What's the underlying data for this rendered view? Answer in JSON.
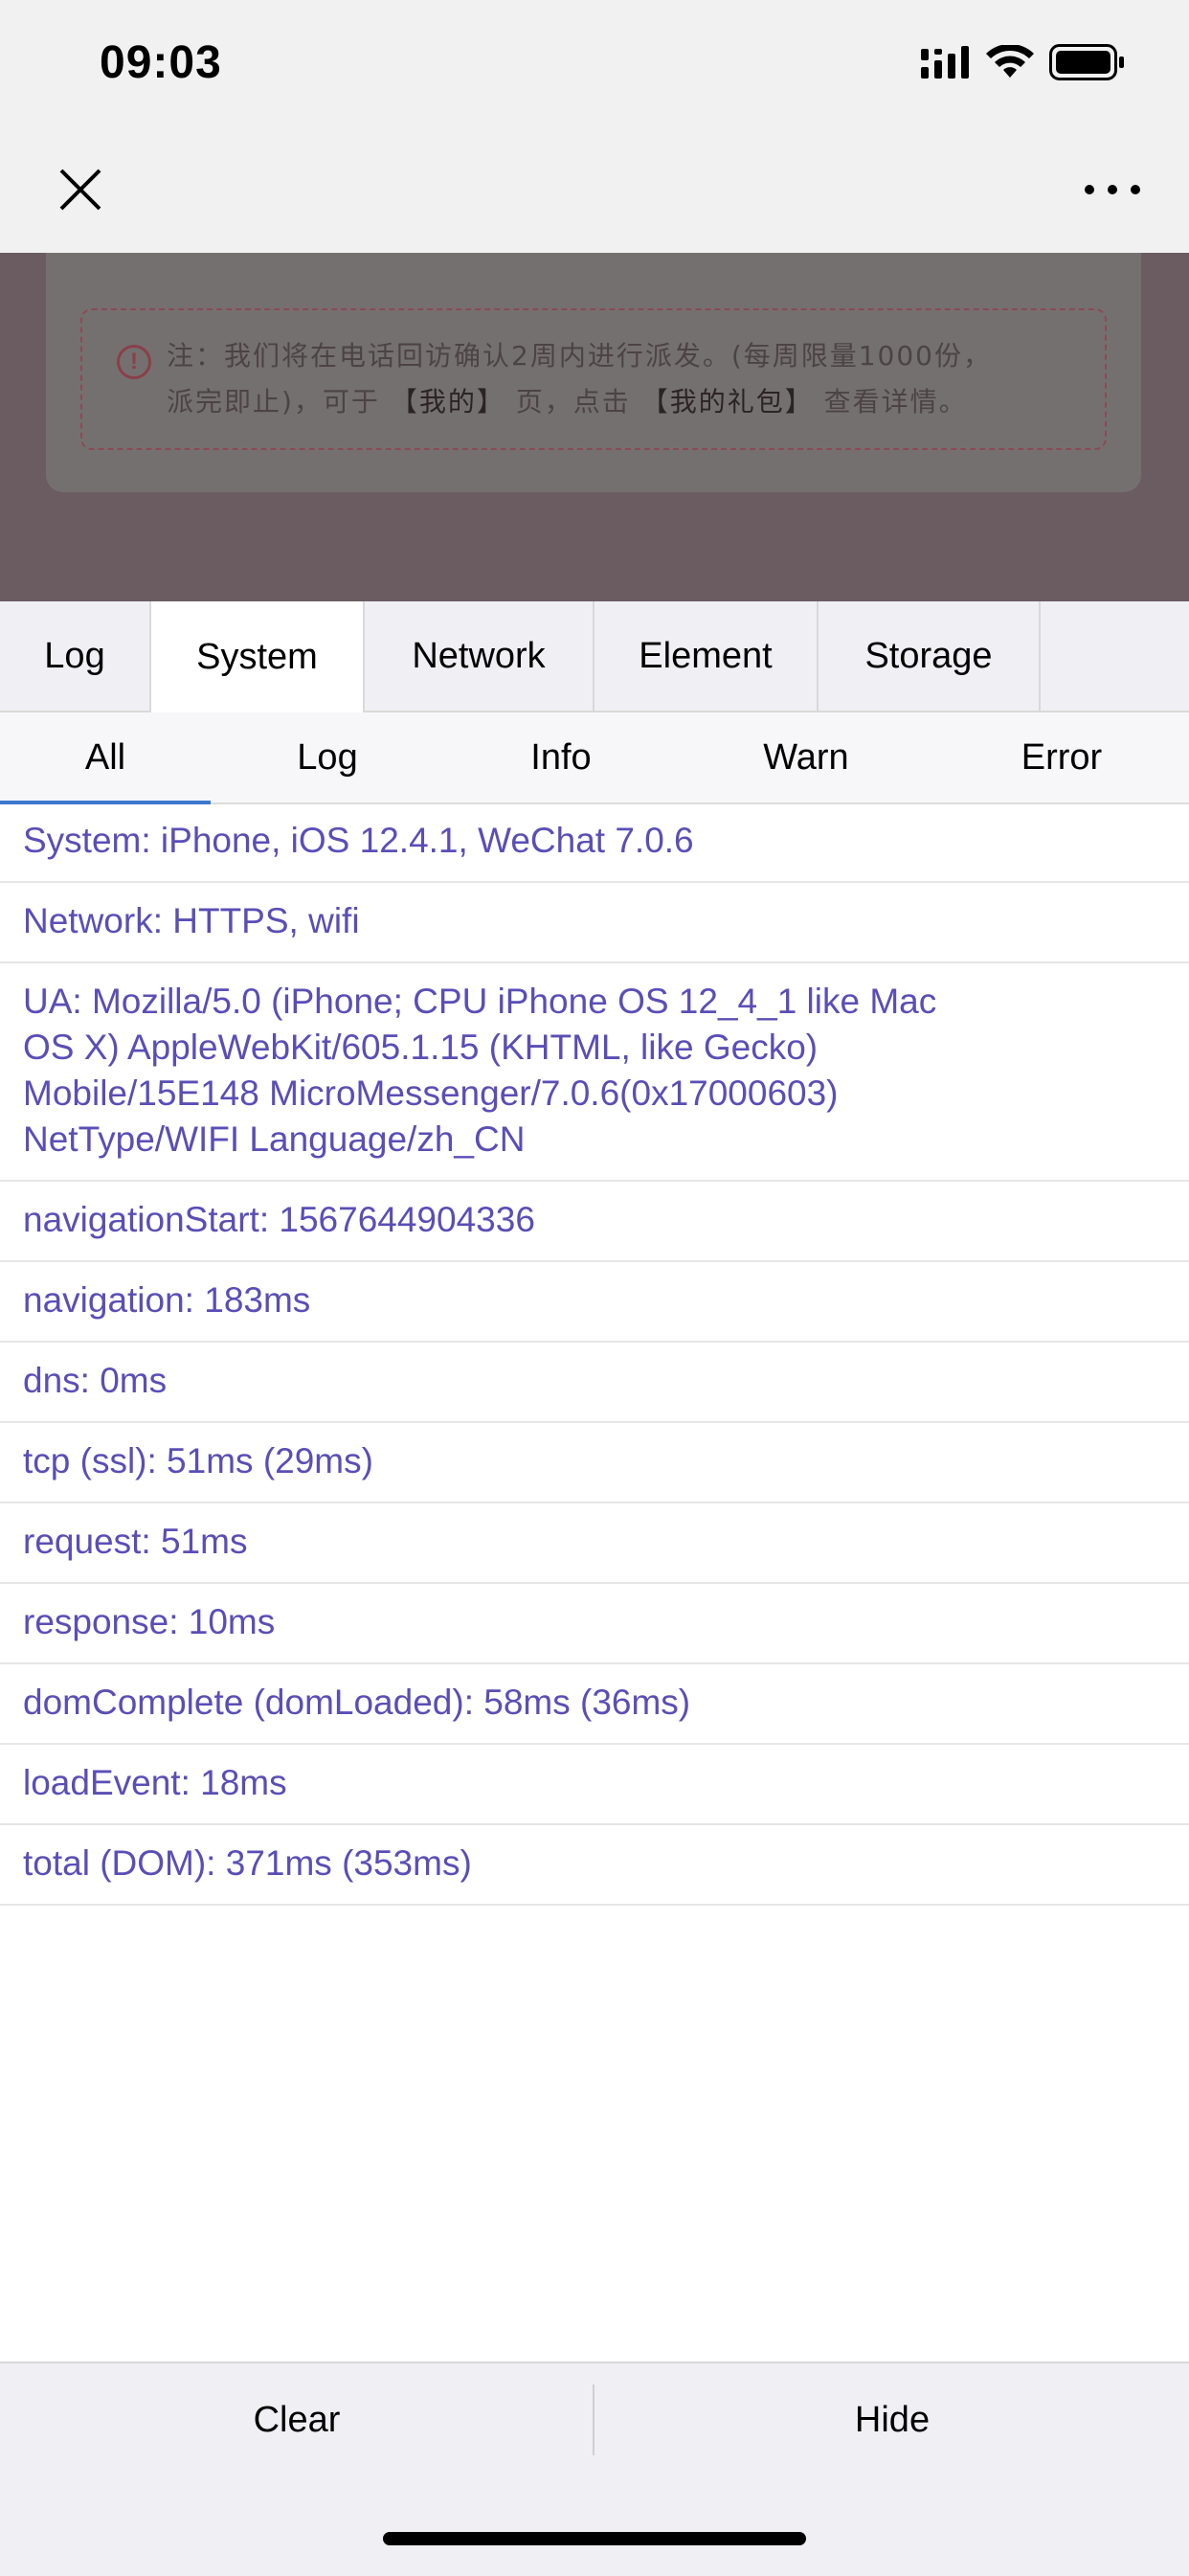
{
  "status_bar": {
    "time": "09:03",
    "icons": [
      "signal-icon",
      "wifi-icon",
      "battery-icon"
    ]
  },
  "nav_bar": {
    "close_icon": "close-icon",
    "more_icon": "more-icon"
  },
  "background_page": {
    "notice_line1": "注：我们将在电话回访确认2周内进行派发。(每周限量1000份，",
    "notice_line2_a": "派完即止)，可于",
    "notice_hl1": "【我的】",
    "notice_line2_b": "页，点击",
    "notice_hl2": "【我的礼包】",
    "notice_line2_c": "查看详情。"
  },
  "console": {
    "main_tabs": [
      {
        "label": "Log"
      },
      {
        "label": "System"
      },
      {
        "label": "Network"
      },
      {
        "label": "Element"
      },
      {
        "label": "Storage"
      }
    ],
    "active_main_tab": "System",
    "sub_tabs": [
      {
        "label": "All"
      },
      {
        "label": "Log"
      },
      {
        "label": "Info"
      },
      {
        "label": "Warn"
      },
      {
        "label": "Error"
      }
    ],
    "active_sub_tab": "All",
    "logs": [
      "System: iPhone, iOS 12.4.1, WeChat 7.0.6",
      "Network: HTTPS, wifi",
      "navigationStart: 1567644904336",
      "navigation: 183ms",
      "dns: 0ms",
      "tcp (ssl): 51ms (29ms)",
      "request: 51ms",
      "response: 10ms",
      "domComplete (domLoaded): 58ms (36ms)",
      "loadEvent: 18ms",
      "total (DOM): 371ms (353ms)"
    ],
    "ua_lines": [
      "UA: Mozilla/5.0 (iPhone; CPU iPhone OS 12_4_1 like Mac",
      "OS X) AppleWebKit/605.1.15 (KHTML, like Gecko)",
      "Mobile/15E148 MicroMessenger/7.0.6(0x17000603)",
      "NetType/WIFI Language/zh_CN"
    ],
    "toolbar": {
      "clear_label": "Clear",
      "hide_label": "Hide"
    },
    "colors": {
      "log_text": "#5a4eb6",
      "active_underline": "#3d77cf",
      "tab_bar_bg": "#efeff4"
    }
  }
}
